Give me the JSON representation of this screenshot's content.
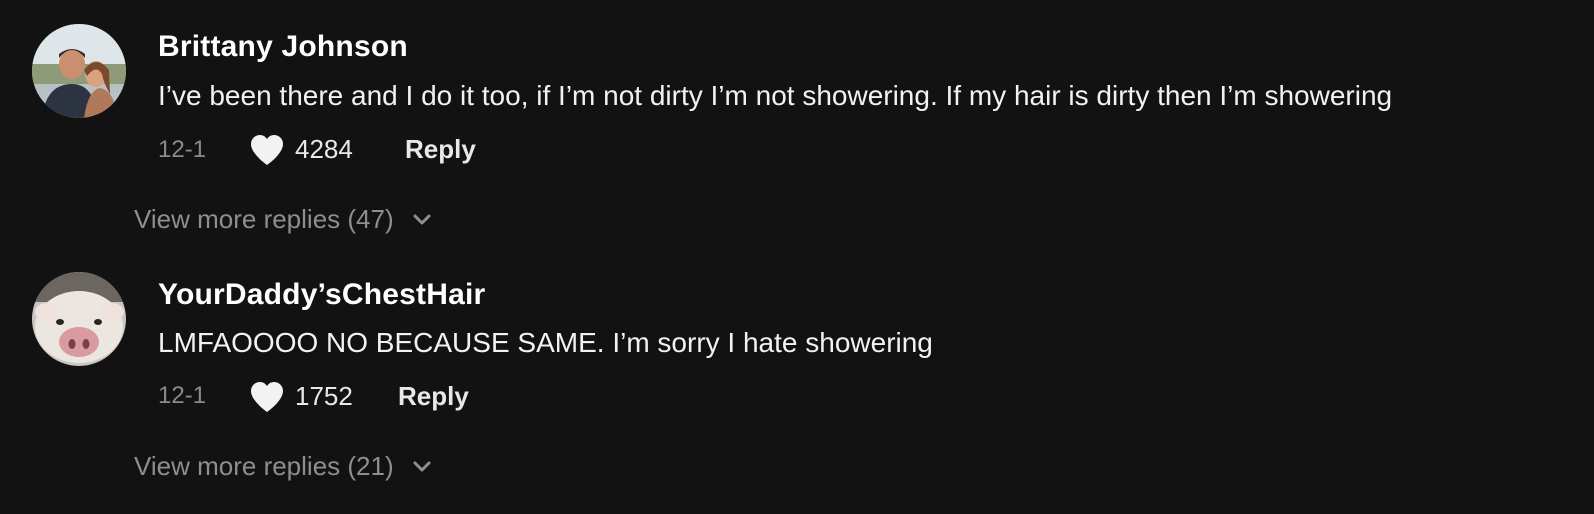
{
  "comments": [
    {
      "username": "Brittany Johnson",
      "text": "I’ve been there and I do it too, if I’m not dirty I’m not showering. If my hair is dirty then I’m showering",
      "date": "12-1",
      "likes": "4284",
      "reply_label": "Reply",
      "view_more": "View more replies (47)",
      "like_icon": "heart-icon",
      "expand_icon": "chevron-down-icon"
    },
    {
      "username": "YourDaddy’sChestHair",
      "text": "LMFAOOOO NO BECAUSE SAME. I’m sorry I hate showering",
      "date": "12-1",
      "likes": "1752",
      "reply_label": "Reply",
      "view_more": "View more replies (21)",
      "like_icon": "heart-icon",
      "expand_icon": "chevron-down-icon"
    }
  ],
  "colors": {
    "background": "#121212",
    "text": "#ffffff",
    "muted": "#8a8a8a"
  }
}
